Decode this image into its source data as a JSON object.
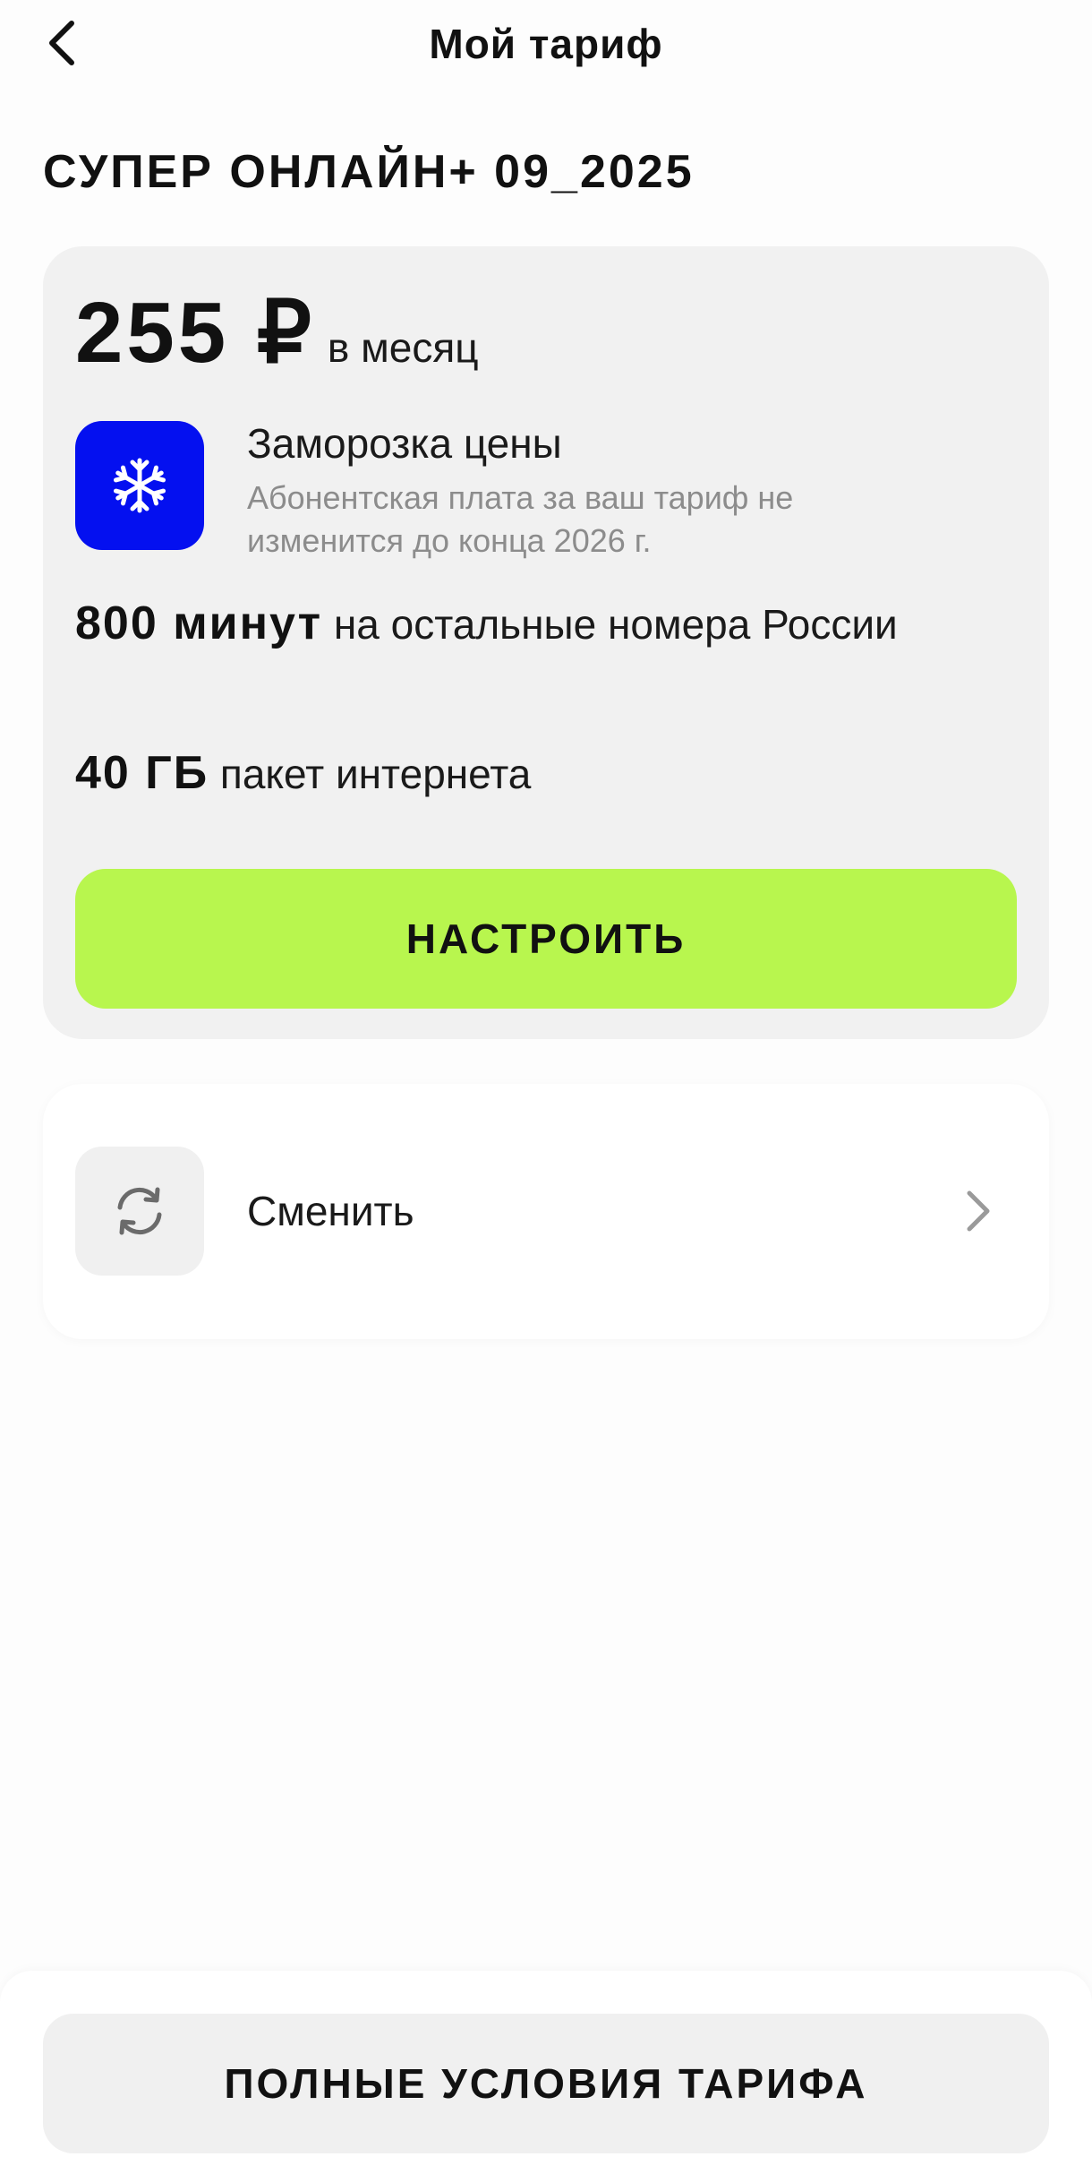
{
  "header": {
    "title": "Мой тариф",
    "back_icon": "chevron-left-icon"
  },
  "tariff": {
    "name": "СУПЕР ОНЛАЙН+ 09_2025",
    "price": "255 ₽",
    "period": "в месяц",
    "freeze": {
      "icon": "snowflake-icon",
      "title": "Заморозка цены",
      "description": "Абонентская плата за ваш тариф не изменится до конца 2026 г."
    },
    "minutes": {
      "value": "800 минут",
      "text": "на остальные номера России"
    },
    "internet": {
      "value": "40 ГБ",
      "text": "пакет интернета"
    },
    "configure_label": "НАСТРОИТЬ"
  },
  "change": {
    "icon": "refresh-icon",
    "label": "Сменить",
    "chevron_icon": "chevron-right-icon"
  },
  "footer": {
    "terms_label": "ПОЛНЫЕ УСЛОВИЯ ТАРИФА"
  },
  "colors": {
    "accent_green": "#b8f64e",
    "freeze_blue": "#0410f0",
    "card_gray": "#f1f1f1"
  }
}
